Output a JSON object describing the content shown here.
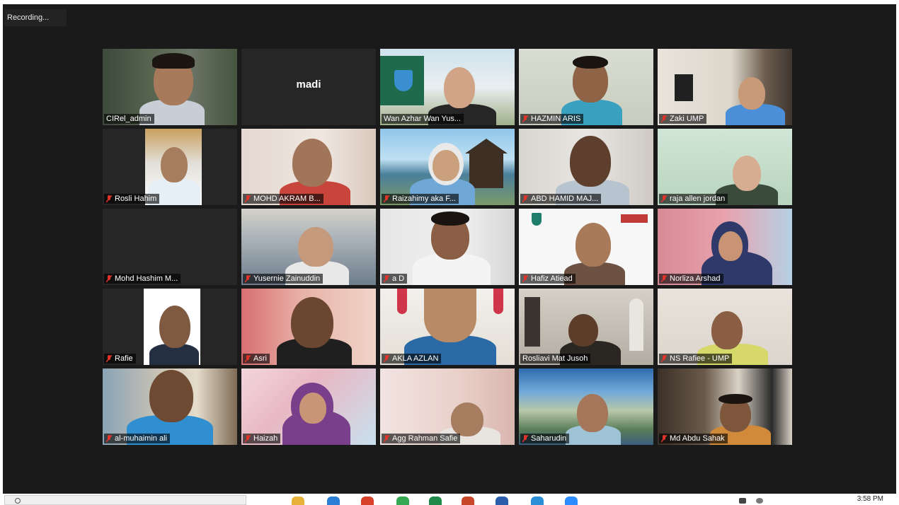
{
  "recording_label": "Recording...",
  "clock_time": "3:58 PM",
  "colors": {
    "active_speaker_border": "#c3e34a",
    "muted_mic": "#e0342b",
    "window_bg": "#1a1a1a"
  },
  "participants": [
    {
      "name": "CIRel_admin",
      "muted": false,
      "active": true
    },
    {
      "name": "madi",
      "video_off": true
    },
    {
      "name": "Wan Azhar Wan Yus...",
      "muted": false
    },
    {
      "name": "HAZMIN ARIS",
      "muted": true
    },
    {
      "name": "Zaki UMP",
      "muted": true
    },
    {
      "name": "Rosli Hahim",
      "muted": true
    },
    {
      "name": "MOHD AKRAM B...",
      "muted": true
    },
    {
      "name": "Raizahimy aka F...",
      "muted": true
    },
    {
      "name": "ABD HAMID MAJ...",
      "muted": true
    },
    {
      "name": "raja allen jordan",
      "muted": true
    },
    {
      "name": "Mohd Hashim M...",
      "muted": true
    },
    {
      "name": "Yusernie Zainuddin",
      "muted": true
    },
    {
      "name": "a D",
      "muted": true
    },
    {
      "name": "Hafiz Atiead",
      "muted": true
    },
    {
      "name": "Norliza Arshad",
      "muted": true
    },
    {
      "name": "Rafie",
      "muted": true
    },
    {
      "name": "Asri",
      "muted": true
    },
    {
      "name": "AKLA AZLAN",
      "muted": true
    },
    {
      "name": "Rosliavi Mat Jusoh",
      "muted": false
    },
    {
      "name": "NS Rafiee - UMP",
      "muted": true
    },
    {
      "name": "al-muhaimin ali",
      "muted": true
    },
    {
      "name": "Haizah",
      "muted": true
    },
    {
      "name": "Agg Rahman Safie",
      "muted": true
    },
    {
      "name": "Saharudin",
      "muted": true
    },
    {
      "name": "Md Abdu Sahak",
      "muted": true
    }
  ]
}
